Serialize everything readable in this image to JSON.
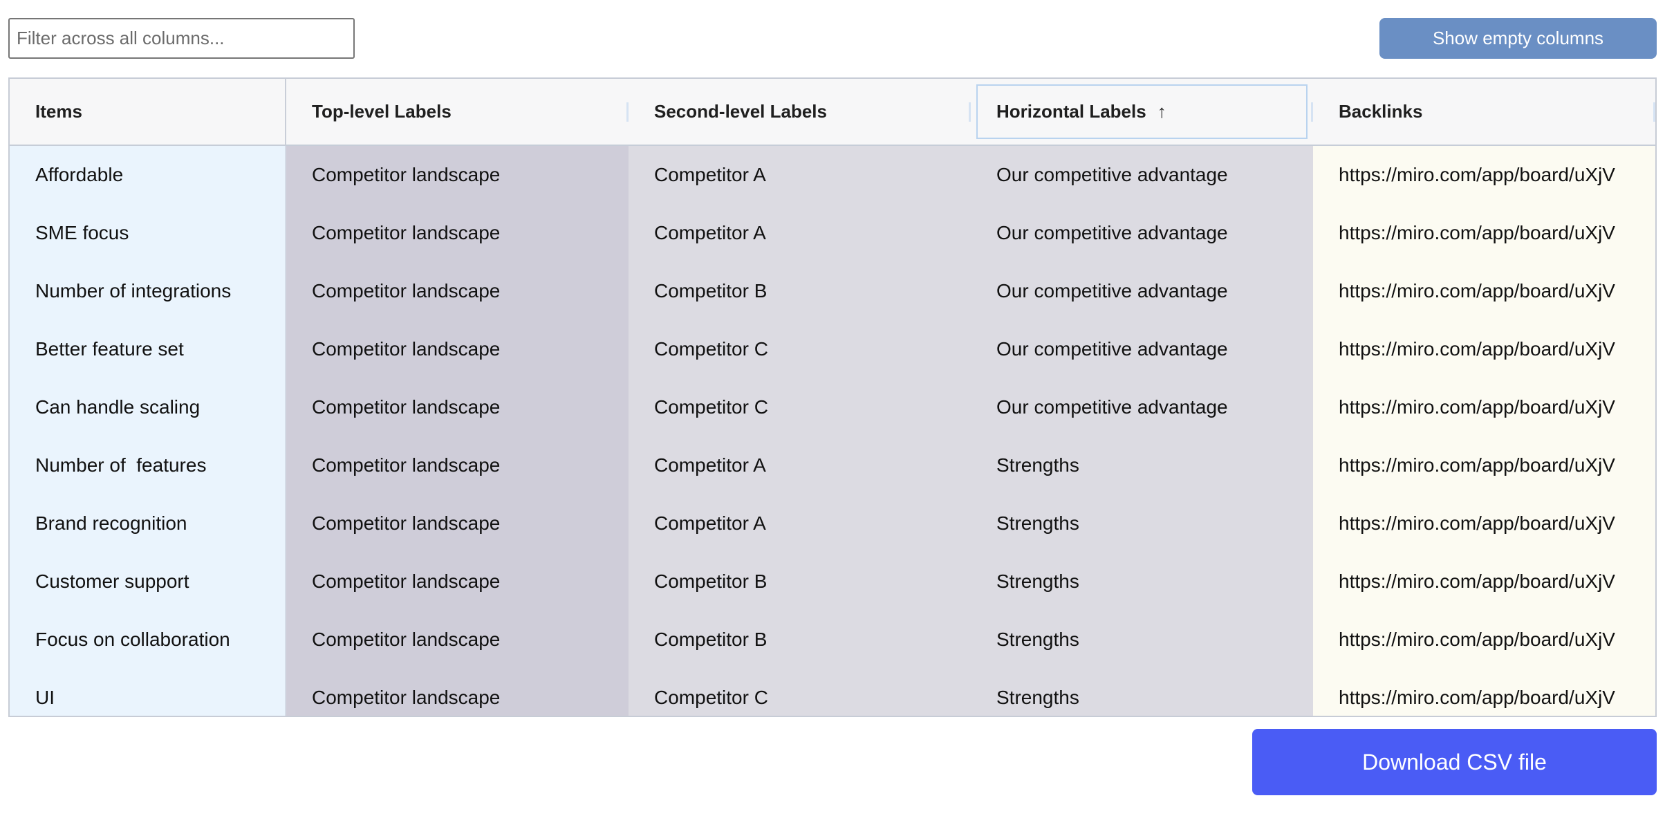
{
  "filter": {
    "placeholder": "Filter across all columns...",
    "value": ""
  },
  "toolbar": {
    "show_empty_label": "Show empty columns",
    "download_label": "Download CSV file"
  },
  "colors": {
    "show_empty_button": "#6a8fc4",
    "download_button": "#4a5cf5",
    "items_column": "#eaf4fd",
    "top_level_column": "#cfcdd9",
    "second_level_column": "#dcdbe2",
    "horizontal_column": "#dcdbe2",
    "backlinks_column": "#fcfbf2"
  },
  "table": {
    "headers": {
      "items": "Items",
      "top_level": "Top-level Labels",
      "second_level": "Second-level Labels",
      "horizontal": "Horizontal Labels",
      "backlinks": "Backlinks"
    },
    "sorted_column": "horizontal",
    "sort_direction": "ascending",
    "sort_icon": "arrow-up-icon",
    "rows": [
      {
        "item": "Affordable",
        "top": "Competitor landscape",
        "second": "Competitor A",
        "horizontal": "Our competitive advantage",
        "backlink": "https://miro.com/app/board/uXjV"
      },
      {
        "item": "SME focus",
        "top": "Competitor landscape",
        "second": "Competitor A",
        "horizontal": "Our competitive advantage",
        "backlink": "https://miro.com/app/board/uXjV"
      },
      {
        "item": "Number of integrations",
        "top": "Competitor landscape",
        "second": "Competitor B",
        "horizontal": "Our competitive advantage",
        "backlink": "https://miro.com/app/board/uXjV"
      },
      {
        "item": "Better feature set",
        "top": "Competitor landscape",
        "second": "Competitor C",
        "horizontal": "Our competitive advantage",
        "backlink": "https://miro.com/app/board/uXjV"
      },
      {
        "item": "Can handle scaling",
        "top": "Competitor landscape",
        "second": "Competitor C",
        "horizontal": "Our competitive advantage",
        "backlink": "https://miro.com/app/board/uXjV"
      },
      {
        "item": "Number of  features",
        "top": "Competitor landscape",
        "second": "Competitor A",
        "horizontal": "Strengths",
        "backlink": "https://miro.com/app/board/uXjV"
      },
      {
        "item": "Brand recognition",
        "top": "Competitor landscape",
        "second": "Competitor A",
        "horizontal": "Strengths",
        "backlink": "https://miro.com/app/board/uXjV"
      },
      {
        "item": "Customer support",
        "top": "Competitor landscape",
        "second": "Competitor B",
        "horizontal": "Strengths",
        "backlink": "https://miro.com/app/board/uXjV"
      },
      {
        "item": "Focus on collaboration",
        "top": "Competitor landscape",
        "second": "Competitor B",
        "horizontal": "Strengths",
        "backlink": "https://miro.com/app/board/uXjV"
      },
      {
        "item": "UI",
        "top": "Competitor landscape",
        "second": "Competitor C",
        "horizontal": "Strengths",
        "backlink": "https://miro.com/app/board/uXjV"
      }
    ]
  }
}
